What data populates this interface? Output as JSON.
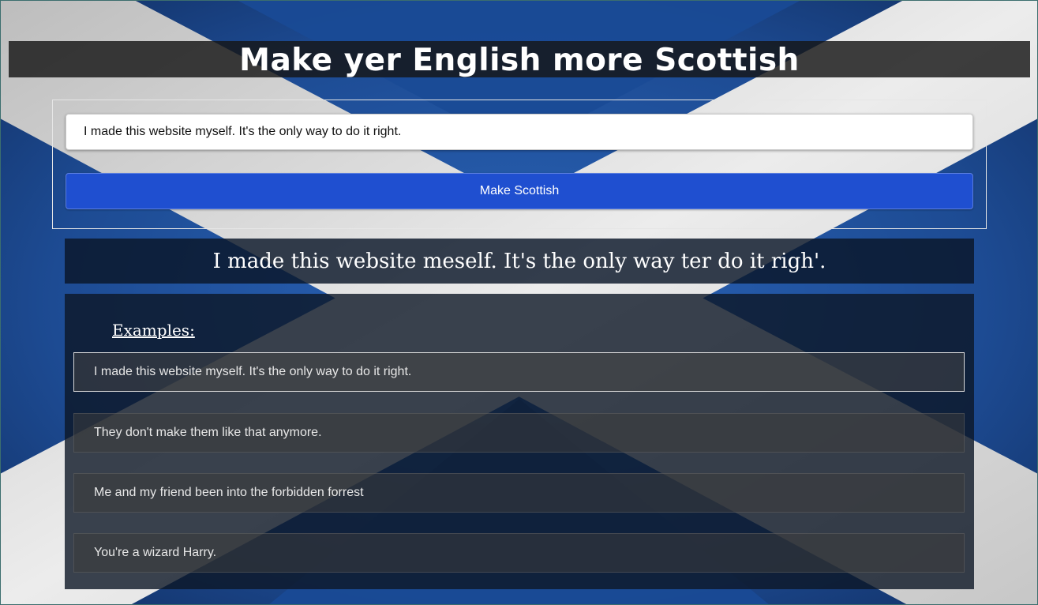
{
  "header": {
    "title": "Make yer English more Scottish"
  },
  "form": {
    "input_value": "I made this website myself. It's the only way to do it right.",
    "button_label": "Make Scottish"
  },
  "result": {
    "text": "I made this website meself. It's the only way ter do it righ'."
  },
  "examples": {
    "heading": "Examples:",
    "items": [
      "I made this website myself. It's the only way to do it right.",
      "They don't make them like that anymore.",
      "Me and my friend been into the forbidden forrest",
      "You're a wizard Harry."
    ]
  },
  "colors": {
    "flag_blue": "#1f4f98",
    "saltire_white": "#e6e6e6",
    "button_blue": "#1f4fd0"
  }
}
